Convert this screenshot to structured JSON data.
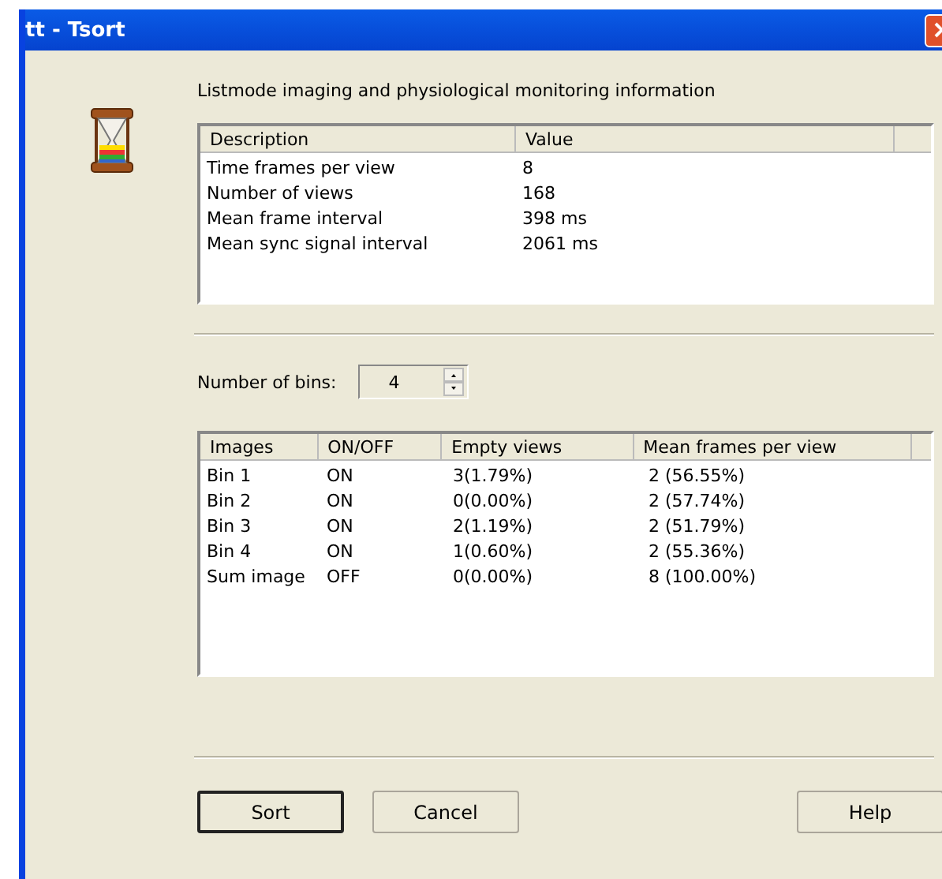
{
  "window": {
    "title": "tt - Tsort"
  },
  "heading": "Listmode imaging and physiological monitoring information",
  "info_table": {
    "columns": [
      "Description",
      "Value"
    ],
    "rows": [
      [
        "Time frames per view",
        "8"
      ],
      [
        "Number of views",
        "168"
      ],
      [
        "Mean frame interval",
        "398 ms"
      ],
      [
        "Mean sync signal interval",
        "2061 ms"
      ]
    ]
  },
  "bins": {
    "label": "Number of bins:",
    "value": "4"
  },
  "images_table": {
    "columns": [
      "Images",
      "ON/OFF",
      "Empty views",
      "Mean frames per view"
    ],
    "rows": [
      [
        "Bin 1",
        "ON",
        "3(1.79%)",
        "2 (56.55%)"
      ],
      [
        "Bin 2",
        "ON",
        "0(0.00%)",
        "2 (57.74%)"
      ],
      [
        "Bin 3",
        "ON",
        "2(1.19%)",
        "2 (51.79%)"
      ],
      [
        "Bin 4",
        "ON",
        "1(0.60%)",
        "2 (55.36%)"
      ],
      [
        "Sum image",
        "OFF",
        "0(0.00%)",
        "8 (100.00%)"
      ]
    ]
  },
  "buttons": [
    {
      "label": "Sort",
      "default": true
    },
    {
      "label": "Cancel",
      "default": false
    },
    {
      "label": "Help",
      "default": false
    }
  ]
}
